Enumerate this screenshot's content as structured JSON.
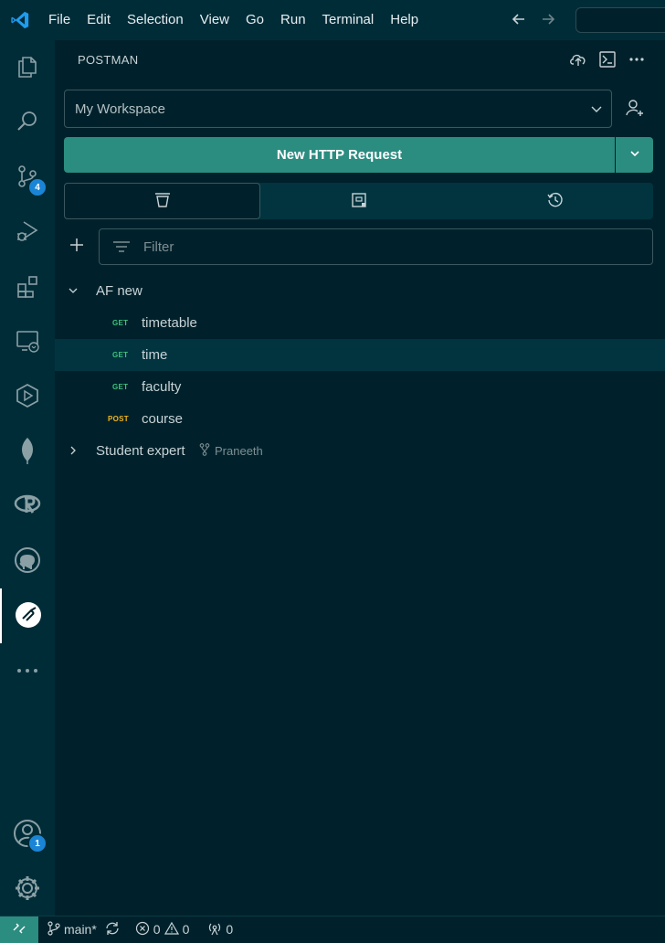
{
  "menu": [
    "File",
    "Edit",
    "Selection",
    "View",
    "Go",
    "Run",
    "Terminal",
    "Help"
  ],
  "activity": {
    "source_control_badge": "4",
    "accounts_badge": "1"
  },
  "panel": {
    "title": "POSTMAN"
  },
  "workspace": {
    "selected": "My Workspace"
  },
  "new_request": {
    "label": "New HTTP Request"
  },
  "filter": {
    "placeholder": "Filter"
  },
  "collections": [
    {
      "name": "AF new",
      "expanded": true,
      "requests": [
        {
          "method": "GET",
          "name": "timetable"
        },
        {
          "method": "GET",
          "name": "time",
          "selected": true
        },
        {
          "method": "GET",
          "name": "faculty"
        },
        {
          "method": "POST",
          "name": "course"
        }
      ]
    },
    {
      "name": "Student expert",
      "expanded": false,
      "fork_owner": "Praneeth"
    }
  ],
  "status": {
    "branch": "main*",
    "errors": "0",
    "warnings": "0",
    "ports": "0"
  },
  "colors": {
    "accent": "#2b8c80",
    "get": "#3ec27a",
    "post": "#f2b51f",
    "badge": "#1a85d6"
  }
}
